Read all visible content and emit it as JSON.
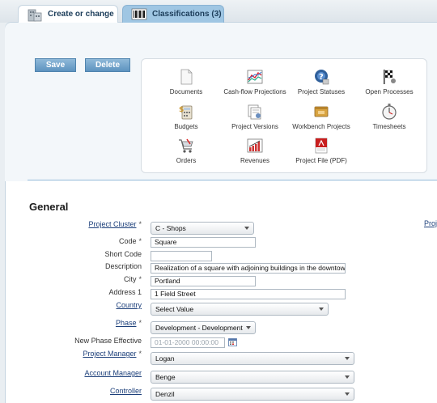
{
  "tabs": [
    {
      "label": "Create or change",
      "icon": "building-icon",
      "active": true
    },
    {
      "label": "Classifications (3)",
      "icon": "barcode-icon",
      "active": false
    }
  ],
  "toolbar": {
    "save_label": "Save",
    "delete_label": "Delete"
  },
  "quick_links": [
    {
      "label": "Documents",
      "icon": "document-icon"
    },
    {
      "label": "Cash-flow Projections",
      "icon": "line-chart-icon"
    },
    {
      "label": "Project Statuses",
      "icon": "status-globe-icon"
    },
    {
      "label": "Open Processes",
      "icon": "checkered-flag-icon"
    },
    {
      "label": "Budgets",
      "icon": "calculator-icon"
    },
    {
      "label": "Project Versions",
      "icon": "versions-icon"
    },
    {
      "label": "Workbench Projects",
      "icon": "workbench-icon"
    },
    {
      "label": "Timesheets",
      "icon": "stopwatch-icon"
    },
    {
      "label": "Orders",
      "icon": "shopping-cart-icon"
    },
    {
      "label": "Revenues",
      "icon": "bar-chart-icon"
    },
    {
      "label": "Project File (PDF)",
      "icon": "pdf-icon"
    }
  ],
  "section": {
    "title": "General"
  },
  "right_label_partial": "Proj",
  "form": {
    "project_cluster": {
      "label": "Project Cluster",
      "value": "C - Shops"
    },
    "code": {
      "label": "Code",
      "value": "Square"
    },
    "short_code": {
      "label": "Short Code",
      "value": ""
    },
    "description": {
      "label": "Description",
      "value": "Realization of a square with adjoining buildings in the downtown, w"
    },
    "city": {
      "label": "City",
      "value": "Portland"
    },
    "address1": {
      "label": "Address 1",
      "value": "1 Field Street"
    },
    "country": {
      "label": "Country",
      "value": "Select Value"
    },
    "phase": {
      "label": "Phase",
      "value": "Development - Development"
    },
    "new_phase_effective": {
      "label": "New Phase Effective",
      "placeholder": "01-01-2000 00:00:00"
    },
    "project_manager": {
      "label": "Project Manager",
      "value": "Logan"
    },
    "account_manager": {
      "label": "Account Manager",
      "value": "Benge"
    },
    "controller": {
      "label": "Controller",
      "value": "Denzil"
    }
  },
  "required_marker": "*",
  "colors": {
    "accent": "#5d93bf",
    "link": "#1c3f7a",
    "tab_inactive": "#9fc6e3"
  }
}
